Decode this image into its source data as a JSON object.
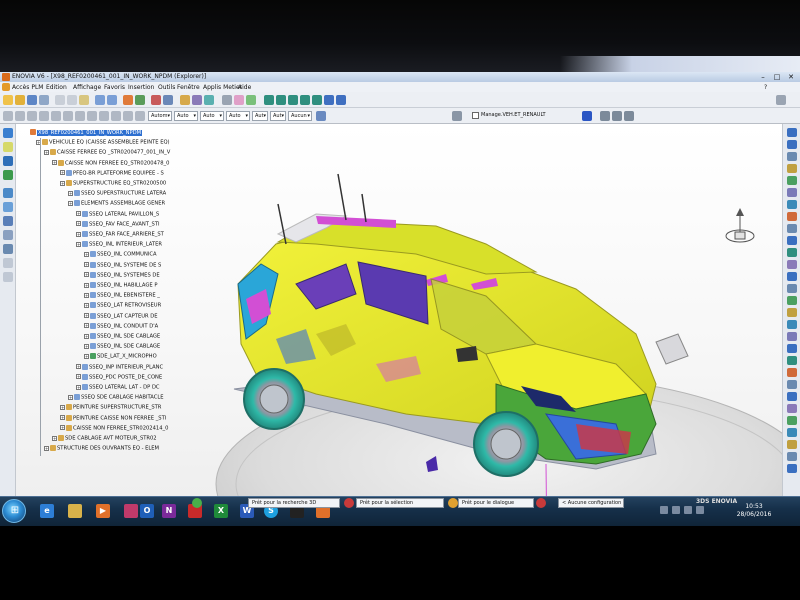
{
  "window": {
    "title": "ENOVIA V6 - [X98_REF0200461_001_IN_WORK_NPDM (Explorer)]",
    "minimize": "–",
    "maximize": "□",
    "close": "✕"
  },
  "menu": {
    "items": [
      "Accès PLM",
      "Edition",
      "Affichage",
      "Favoris",
      "Insertion",
      "Outils",
      "Fenêtre",
      "Applis Metier",
      "Aide"
    ]
  },
  "toolbar2": {
    "combos": [
      "Autom",
      "Auto",
      "Auto",
      "Auto",
      "Aut",
      "Aut",
      "Aucun"
    ],
    "checkbox_label": "Manage.VEH.ET_RENAULT"
  },
  "tree": {
    "nodes": [
      {
        "label": "X98_REF0200461_001_IN_WORK_NPDM",
        "selected": true
      },
      {
        "label": "VEHICULE EQ (CAISSE ASSEMBLEE PEINTE EQ)"
      },
      {
        "label": "CAISSE FERREE EQ _STR0200477_001_IN_V"
      },
      {
        "label": "CAISSE NON FERREE EQ_STR0200478_0"
      },
      {
        "label": "PFEQ-BR PLATEFORME EQUIPEE - S"
      },
      {
        "label": "SUPERSTRUCTURE EQ_STR0200500"
      },
      {
        "label": "SSEQ SUPERSTRUCTURE LATERA"
      },
      {
        "label": "ELEMENTS ASSEMBLAGE GENER"
      },
      {
        "label": "SSEQ LATERAL PAVILLON_S"
      },
      {
        "label": "SSEQ_FAV FACE_AVANT_STI"
      },
      {
        "label": "SSEQ_FAR FACE_ARRIERE_ST"
      },
      {
        "label": "SSEQ_INL INTERIEUR_LATER"
      },
      {
        "label": "SSEQ_INL COMMUNICA"
      },
      {
        "label": "SSEQ_INL SYSTEME DE S"
      },
      {
        "label": "SSEQ_INL SYSTEMES DE"
      },
      {
        "label": "SSEQ_INL HABILLAGE P"
      },
      {
        "label": "SSEQ_INL EBENISTERE _"
      },
      {
        "label": "SSEQ_LAT RETROVISEUR"
      },
      {
        "label": "SSEQ_LAT CAPTEUR DE"
      },
      {
        "label": "SSEQ_INL CONDUIT D'A"
      },
      {
        "label": "SSEQ_INL SDE CABLAGE"
      },
      {
        "label": "SSEQ_INL SDE CABLAGE"
      },
      {
        "label": "SDE_LAT_X_MICROPHO"
      },
      {
        "label": "SSEQ_INP INTERIEUR_PLANC"
      },
      {
        "label": "SSEQ_PDC POSTE_DE_CONE"
      },
      {
        "label": "SSEQ LATERAL LAT - DP DC"
      },
      {
        "label": "SSEQ SDE CABLAGE HABITACLE"
      },
      {
        "label": "PEINTURE SUPERSTRUCTURE_STR"
      },
      {
        "label": "PEINTURE CAISSE NON FERREE _STI"
      },
      {
        "label": "CAISSE NON FERREE_STR0202414_0"
      },
      {
        "label": "SDE CABLAGE AVT MOTEUR_STR02"
      },
      {
        "label": "STRUCTURE DES OUVRANTS EQ - ELEM"
      }
    ]
  },
  "prompt": {
    "field1": "Prêt pour la recherche 3D",
    "field2": "Prêt pour la sélection",
    "field3": "Prêt pour le dialogue",
    "config": "< Aucune configuration >"
  },
  "brand": "3DS ENOVIA",
  "clock": {
    "time": "10:53",
    "date": "28/06/2016"
  },
  "colors": {
    "body_yellow": "#ecec2a",
    "wheel_teal": "#2fb9a8",
    "magenta": "#d24fd4",
    "blue": "#3a6fd8",
    "green": "#4aa63a",
    "purple_glass": "#6a3fb8"
  }
}
